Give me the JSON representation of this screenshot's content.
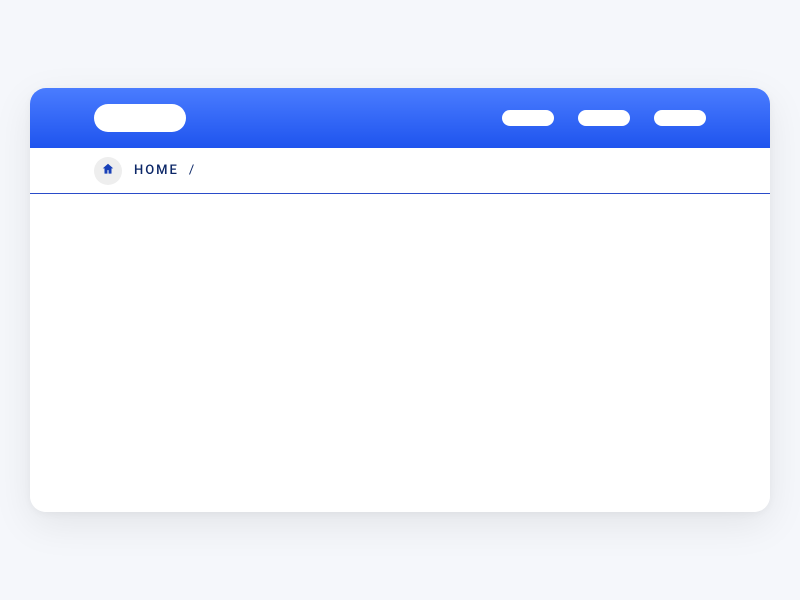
{
  "breadcrumb": {
    "home_label": "Home",
    "separator": "/"
  },
  "icons": {
    "home": "home-icon"
  }
}
